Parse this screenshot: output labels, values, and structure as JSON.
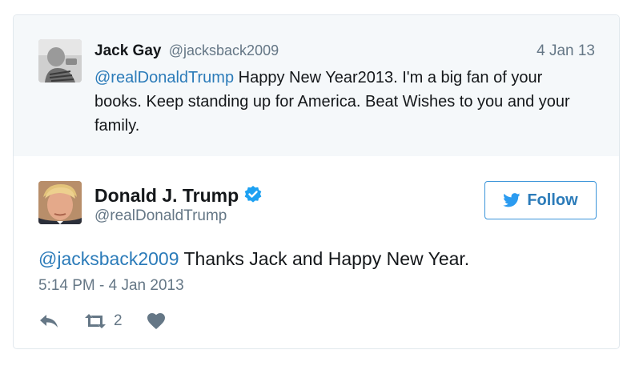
{
  "parent_tweet": {
    "name": "Jack Gay",
    "handle": "@jacksback2009",
    "date": "4 Jan 13",
    "mention": "@realDonaldTrump",
    "text": " Happy New Year2013. I'm a big fan of your books. Keep standing up for America. Beat Wishes to you and your family."
  },
  "tweet": {
    "name": "Donald J. Trump",
    "handle": "@realDonaldTrump",
    "follow_label": "Follow",
    "mention": "@jacksback2009",
    "text": " Thanks Jack and Happy New Year.",
    "timestamp": "5:14 PM - 4 Jan 2013",
    "retweet_count": "2"
  },
  "colors": {
    "link": "#2b7bb9",
    "muted": "#657786",
    "verified": "#1da1f2",
    "parent_bg": "#f5f8fa"
  },
  "icons": [
    "verified-badge-icon",
    "twitter-bird-icon",
    "reply-icon",
    "retweet-icon",
    "heart-icon"
  ]
}
